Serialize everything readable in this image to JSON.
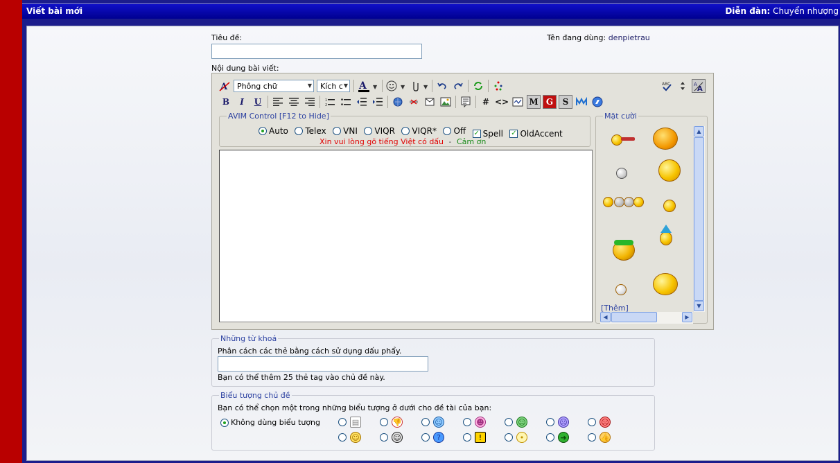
{
  "header": {
    "title": "Viết bài mới",
    "forum_label": "Diễn đàn:",
    "forum_name": "Chuyển nhượng"
  },
  "form": {
    "title_label": "Tiêu đề:",
    "title_value": "",
    "username_label": "Tên đang dùng:",
    "username": "denpietrau",
    "content_label": "Nội dung bài viết:"
  },
  "toolbar": {
    "font_select": "Phông chữ",
    "size_select": "Kích c",
    "bold": "B",
    "italic": "I",
    "underline": "U",
    "hash": "#",
    "code": "<>",
    "m_button": "M",
    "g_button": "G",
    "s_button": "S"
  },
  "avim": {
    "legend": "AVIM Control [F12 to Hide]",
    "options": [
      {
        "label": "Auto",
        "selected": true
      },
      {
        "label": "Telex",
        "selected": false
      },
      {
        "label": "VNI",
        "selected": false
      },
      {
        "label": "VIQR",
        "selected": false
      },
      {
        "label": "VIQR*",
        "selected": false
      },
      {
        "label": "Off",
        "selected": false
      }
    ],
    "spell_label": "Spell",
    "oldaccent_label": "OldAccent",
    "notice_red": "Xin vui lòng gõ tiếng Việt có dấu",
    "notice_sep": "-",
    "notice_green": "Cảm ơn"
  },
  "smilies": {
    "legend": "Mặt cười",
    "more": "[Thêm]"
  },
  "tags": {
    "legend": "Những từ khoá",
    "instruction": "Phân cách các thẻ bằng cách sử dụng dấu phẩy.",
    "value": "",
    "note": "Bạn có thể thêm 25 thẻ tag vào chủ đề này."
  },
  "post_icons": {
    "legend": "Biểu tượng chủ đề",
    "instruction": "Bạn có thể chọn một trong những biểu tượng ở dưới cho đề tài của bạn:",
    "none_label": "Không dùng biểu tượng"
  },
  "colors": {
    "header": "#000090",
    "frame": "#1c1d8c",
    "accent_red": "#b90000",
    "link": "#2a3fa0"
  }
}
